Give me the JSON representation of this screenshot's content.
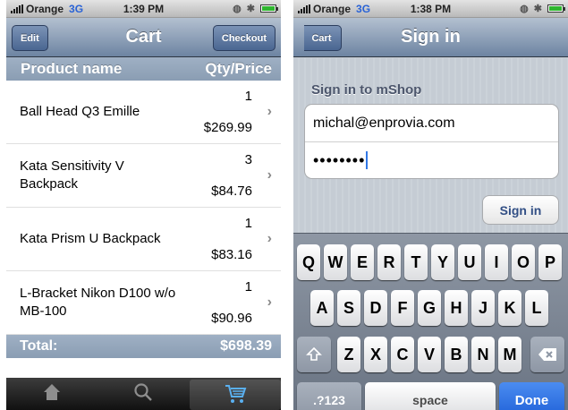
{
  "left": {
    "status": {
      "carrier": "Orange",
      "network": "3G",
      "time": "1:39 PM"
    },
    "nav": {
      "edit": "Edit",
      "title": "Cart",
      "checkout": "Checkout"
    },
    "table": {
      "col_product": "Product name",
      "col_qty_price": "Qty/Price",
      "rows": [
        {
          "name": "Ball Head Q3 Emille",
          "qty": "1",
          "price": "$269.99"
        },
        {
          "name": "Kata Sensitivity V Backpack",
          "qty": "3",
          "price": "$84.76"
        },
        {
          "name": "Kata Prism U Backpack",
          "qty": "1",
          "price": "$83.16"
        },
        {
          "name": "L-Bracket Nikon D100 w/o MB-100",
          "qty": "1",
          "price": "$90.96"
        }
      ]
    },
    "total": {
      "label": "Total:",
      "value": "$698.39"
    },
    "tabs": [
      "home-icon",
      "search-icon",
      "cart-icon"
    ]
  },
  "right": {
    "status": {
      "carrier": "Orange",
      "network": "3G",
      "time": "1:38 PM"
    },
    "nav": {
      "back": "Cart",
      "title": "Sign in"
    },
    "form": {
      "section": "Sign in to mShop",
      "email": "michal@enprovia.com",
      "password_mask": "••••••••",
      "submit": "Sign in"
    },
    "keyboard": {
      "row1": [
        "Q",
        "W",
        "E",
        "R",
        "T",
        "Y",
        "U",
        "I",
        "O",
        "P"
      ],
      "row2": [
        "A",
        "S",
        "D",
        "F",
        "G",
        "H",
        "J",
        "K",
        "L"
      ],
      "row3": [
        "Z",
        "X",
        "C",
        "V",
        "B",
        "N",
        "M"
      ],
      "numbers": ".?123",
      "space": "space",
      "done": "Done"
    }
  },
  "colors": {
    "nav_blue": "#6d84a2",
    "tab_active": "#5ab0f0",
    "done_blue": "#1f61d8"
  }
}
